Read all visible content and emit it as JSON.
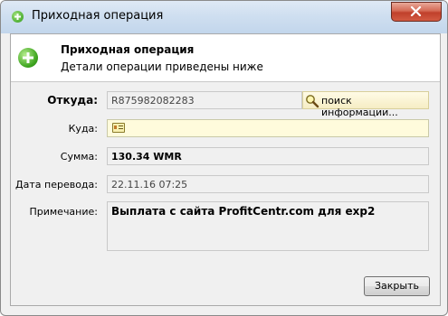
{
  "window": {
    "title": "Приходная операция"
  },
  "header": {
    "title": "Приходная операция",
    "subtitle": "Детали операции приведены ниже"
  },
  "form": {
    "from_label": "Откуда:",
    "from_value": "R875982082283",
    "lookup_button": "поиск информации...",
    "to_label": "Куда:",
    "to_value": "",
    "amount_label": "Сумма:",
    "amount_value": "130.34 WMR",
    "date_label": "Дата перевода:",
    "date_value": "22.11.16 07:25",
    "note_label": "Примечание:",
    "note_value": "Выплата с сайта ProfitCentr.com для exp2"
  },
  "footer": {
    "close_button": "Закрыть"
  },
  "icons": {
    "title": "green-plus-icon",
    "header": "green-plus-icon",
    "lookup": "magnifier-icon",
    "to": "wallet-card-icon",
    "window_close": "close-x-icon"
  },
  "colors": {
    "accent_green": "#3ea51f",
    "close_red": "#c0402b",
    "to_field_bg": "#fffbdc"
  }
}
